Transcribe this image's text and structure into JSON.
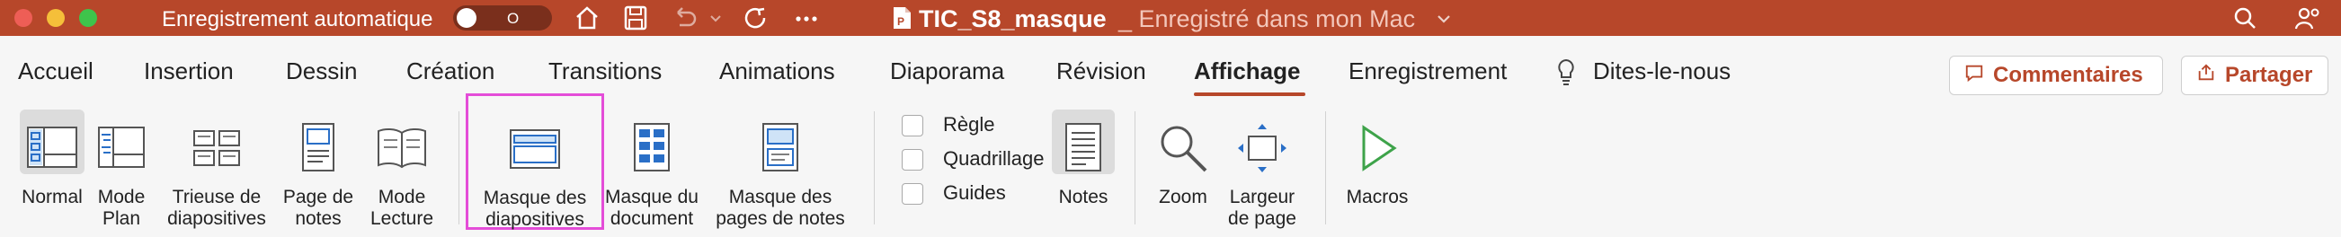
{
  "titlebar": {
    "autosave_label": "Enregistrement automatique",
    "autosave_state": "O",
    "doc_title": "TIC_S8_masque",
    "doc_status": "_ Enregistré dans mon Mac",
    "colors": {
      "bar": "#b7472a",
      "close": "#ee5e56",
      "minimize": "#f5bf3a",
      "zoom": "#3ec44b"
    },
    "icons": [
      "home-icon",
      "save-icon",
      "undo-icon",
      "redo-icon",
      "more-icon",
      "powerpoint-doc-icon",
      "search-icon",
      "share-people-icon"
    ]
  },
  "tabs": [
    {
      "label": "Accueil"
    },
    {
      "label": "Insertion"
    },
    {
      "label": "Dessin"
    },
    {
      "label": "Création"
    },
    {
      "label": "Transitions"
    },
    {
      "label": "Animations"
    },
    {
      "label": "Diaporama"
    },
    {
      "label": "Révision"
    },
    {
      "label": "Affichage",
      "active": true
    },
    {
      "label": "Enregistrement"
    },
    {
      "label": "Dites-le-nous"
    }
  ],
  "header_buttons": {
    "comments": "Commentaires",
    "share": "Partager"
  },
  "ribbon": {
    "normal": "Normal",
    "mode_plan": "Mode\nPlan",
    "trieuse": "Trieuse de\ndiapositives",
    "page_notes": "Page de\nnotes",
    "mode_lecture": "Mode\nLecture",
    "masque_diapos": "Masque des\ndiapositives",
    "masque_document": "Masque du\ndocument",
    "masque_notes": "Masque des\npages de notes",
    "regle": "Règle",
    "quadrillage": "Quadrillage",
    "guides": "Guides",
    "notes": "Notes",
    "zoom": "Zoom",
    "largeur_page": "Largeur\nde page",
    "macros": "Macros"
  }
}
